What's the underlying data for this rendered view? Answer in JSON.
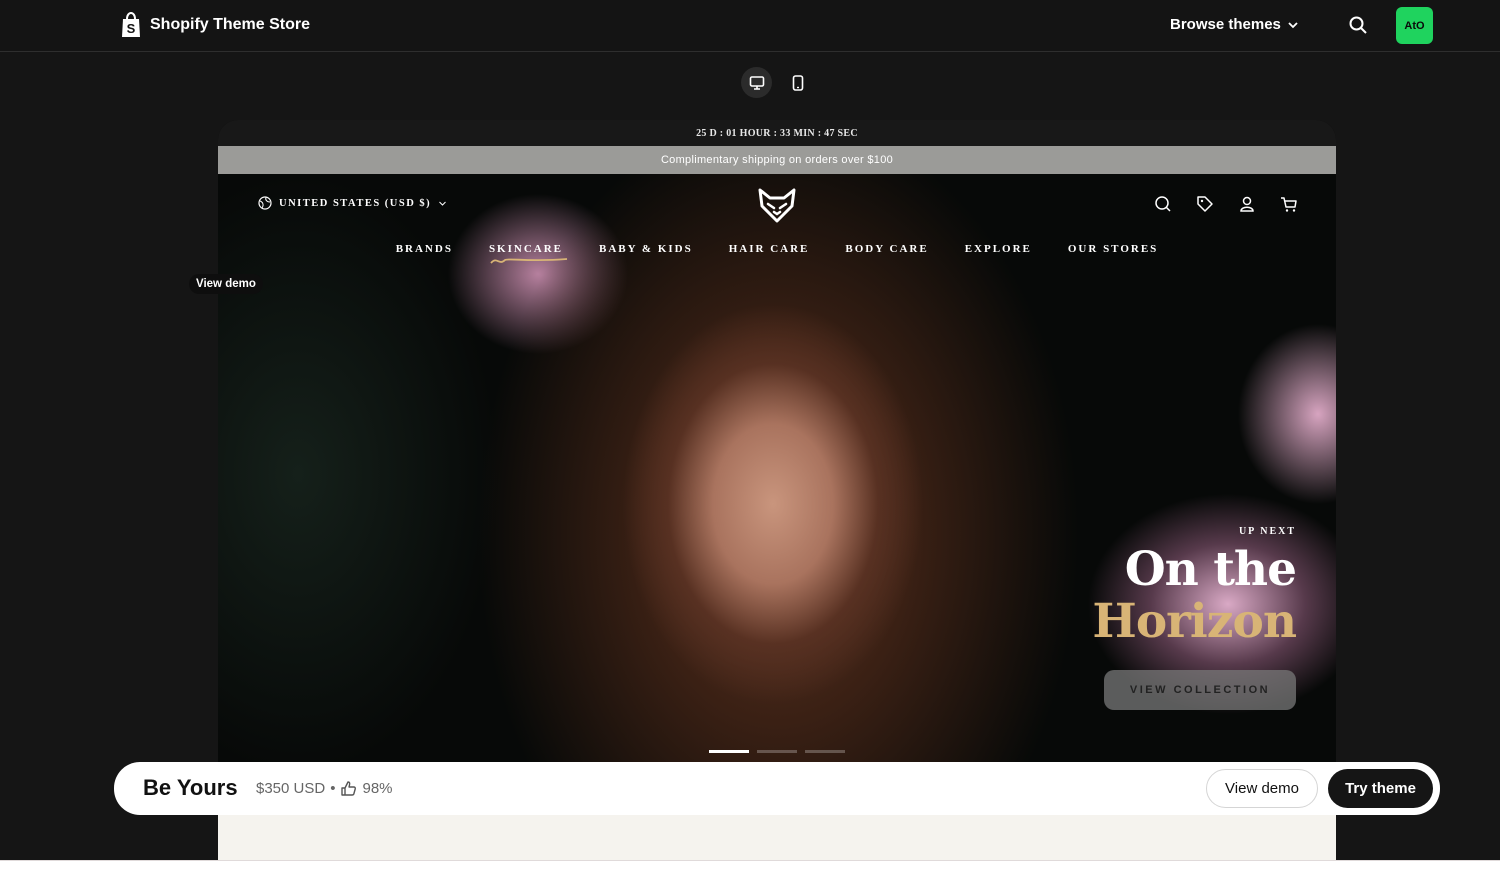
{
  "app": {
    "title": "Shopify Theme Store"
  },
  "topbar": {
    "browse_label": "Browse themes",
    "avatar_initials": "AtO"
  },
  "preview": {
    "countdown": "25 D : 01 HOUR : 33 MIN : 47 SEC",
    "shipping_text": "Complimentary shipping on orders over $100",
    "region_label": "UNITED STATES (USD $)",
    "nav": [
      "BRANDS",
      "SKINCARE",
      "BABY & KIDS",
      "HAIR CARE",
      "BODY CARE",
      "EXPLORE",
      "OUR STORES"
    ],
    "hero": {
      "up_next": "UP NEXT",
      "headline_line1": "On the",
      "headline_line2": "Horizon",
      "cta": "VIEW COLLECTION"
    }
  },
  "view_demo_tag": "View demo",
  "info_bar": {
    "theme_name": "Be Yours",
    "price": "$350 USD",
    "separator": "•",
    "rating": "98%",
    "view_demo": "View demo",
    "try_theme": "Try theme"
  },
  "colors": {
    "avatar": "#1fd35e",
    "accent_gold": "#d8b476"
  }
}
